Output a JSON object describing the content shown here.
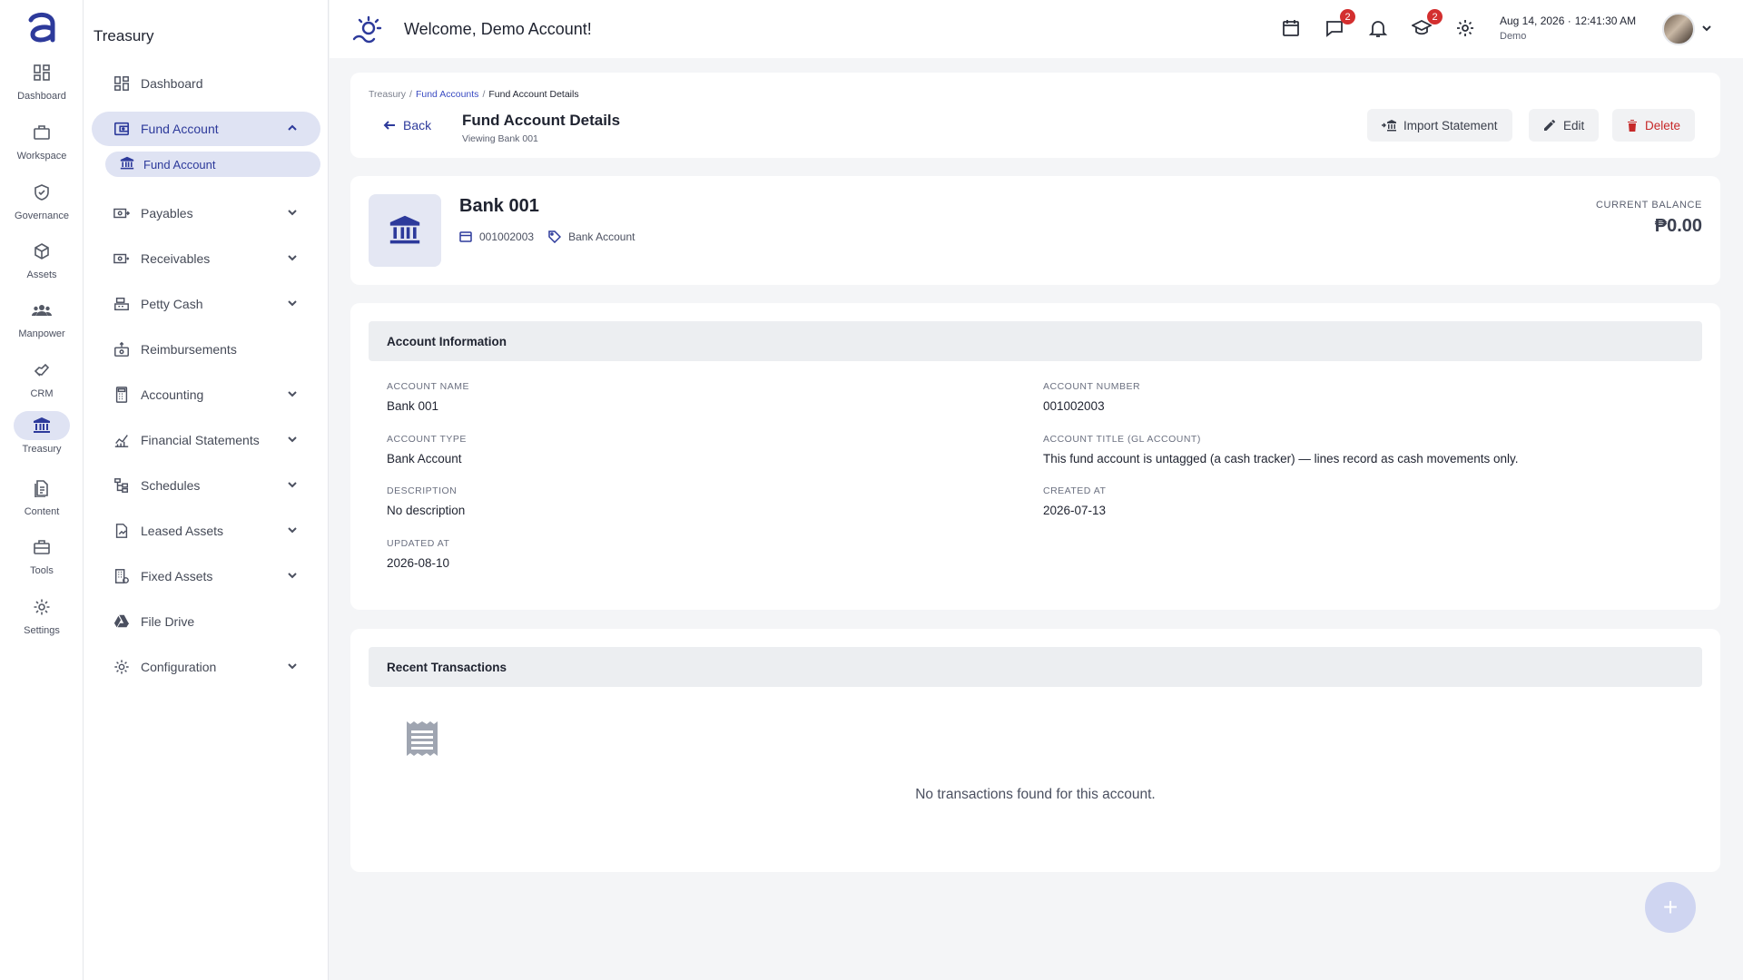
{
  "rail": {
    "items": [
      {
        "label": "Dashboard"
      },
      {
        "label": "Workspace"
      },
      {
        "label": "Governance"
      },
      {
        "label": "Assets"
      },
      {
        "label": "Manpower"
      },
      {
        "label": "CRM"
      },
      {
        "label": "Treasury"
      },
      {
        "label": "Content"
      },
      {
        "label": "Tools"
      },
      {
        "label": "Settings"
      }
    ],
    "active": "Treasury"
  },
  "sidebar": {
    "title": "Treasury",
    "items": [
      {
        "label": "Dashboard"
      },
      {
        "label": "Fund Account"
      },
      {
        "label": "Payables"
      },
      {
        "label": "Receivables"
      },
      {
        "label": "Petty Cash"
      },
      {
        "label": "Reimbursements"
      },
      {
        "label": "Accounting"
      },
      {
        "label": "Financial Statements"
      },
      {
        "label": "Schedules"
      },
      {
        "label": "Leased Assets"
      },
      {
        "label": "Fixed Assets"
      },
      {
        "label": "File Drive"
      },
      {
        "label": "Configuration"
      }
    ],
    "sub_item": {
      "label": "Fund Account"
    }
  },
  "topbar": {
    "welcome": "Welcome, Demo Account!",
    "messages_badge": "2",
    "learning_badge": "2",
    "date": "Aug 14, 2026 ·",
    "time": "12:41:30 AM",
    "user": "Demo"
  },
  "header": {
    "breadcrumb": [
      "Treasury",
      "Fund Accounts",
      "Fund Account Details"
    ],
    "back_label": "Back",
    "title": "Fund Account Details",
    "subtitle": "Viewing Bank 001",
    "import_label": "Import Statement",
    "edit_label": "Edit",
    "delete_label": "Delete"
  },
  "account": {
    "name": "Bank 001",
    "number": "001002003",
    "type": "Bank Account",
    "balance_label": "CURRENT BALANCE",
    "balance": "₱0.00"
  },
  "info": {
    "title": "Account Information",
    "fields": [
      {
        "label": "ACCOUNT NAME",
        "value": "Bank 001"
      },
      {
        "label": "ACCOUNT NUMBER",
        "value": "001002003"
      },
      {
        "label": "ACCOUNT TYPE",
        "value": "Bank Account"
      },
      {
        "label": "ACCOUNT TITLE (GL ACCOUNT)",
        "value": "This fund account is untagged (a cash tracker) — lines record as cash movements only."
      },
      {
        "label": "DESCRIPTION",
        "value": "No description"
      },
      {
        "label": "CREATED AT",
        "value": "2026-07-13"
      },
      {
        "label": "UPDATED AT",
        "value": "2026-08-10"
      }
    ]
  },
  "transactions": {
    "title": "Recent Transactions",
    "empty_text": "No transactions found for this account."
  },
  "fab": {
    "label": "+"
  },
  "colors": {
    "accent": "#2d3a9b",
    "active_bg": "#dfe3f3",
    "danger": "#c62828",
    "badge": "#d32f2f"
  }
}
